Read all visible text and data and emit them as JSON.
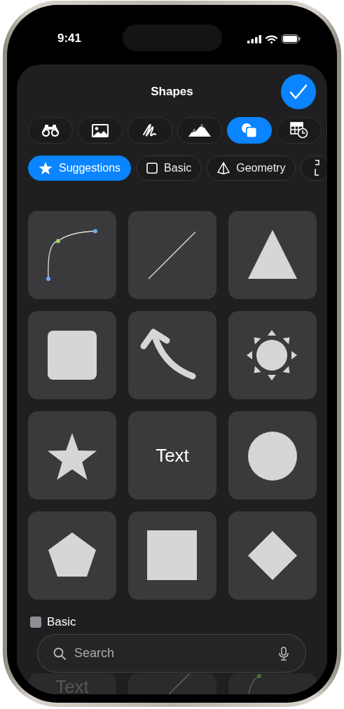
{
  "status_bar": {
    "time": "9:41"
  },
  "sheet": {
    "title": "Shapes"
  },
  "toolbar": [
    {
      "kind": "binoculars",
      "selected": false
    },
    {
      "kind": "image",
      "selected": false
    },
    {
      "kind": "scribble",
      "selected": false
    },
    {
      "kind": "mountains",
      "selected": false
    },
    {
      "kind": "shapes",
      "selected": true
    },
    {
      "kind": "table-clock",
      "selected": false
    },
    {
      "kind": "cut",
      "selected": false
    }
  ],
  "categories": [
    {
      "label": "Suggestions",
      "kind": "star",
      "selected": true
    },
    {
      "label": "Basic",
      "kind": "square",
      "selected": false
    },
    {
      "label": "Geometry",
      "kind": "pyramid",
      "selected": false
    },
    {
      "kind": "cut",
      "selected": false
    }
  ],
  "shapes": [
    {
      "kind": "curve"
    },
    {
      "kind": "line"
    },
    {
      "kind": "triangle"
    },
    {
      "kind": "rounded-square"
    },
    {
      "kind": "arrow"
    },
    {
      "kind": "sun"
    },
    {
      "kind": "star"
    },
    {
      "kind": "text",
      "label": "Text"
    },
    {
      "kind": "circle"
    },
    {
      "kind": "pentagon"
    },
    {
      "kind": "square"
    },
    {
      "kind": "diamond"
    }
  ],
  "section": {
    "title": "Basic"
  },
  "section_shapes": [
    {
      "kind": "text",
      "label": "Text"
    },
    {
      "kind": "line"
    },
    {
      "kind": "curve"
    }
  ],
  "search": {
    "placeholder": "Search"
  }
}
